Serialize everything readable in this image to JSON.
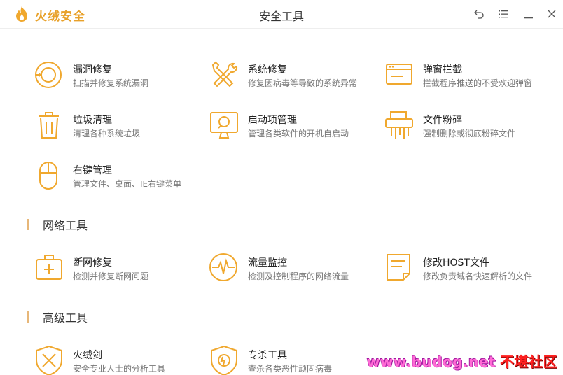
{
  "app": {
    "brand": "火绒安全",
    "window_title": "安全工具"
  },
  "colors": {
    "accent": "#f0a82e",
    "section_bar": "#e7b779",
    "text": "#333333",
    "desc": "#777777"
  },
  "sections": [
    {
      "title": "",
      "tools": [
        {
          "name": "漏洞修复",
          "desc": "扫描并修复系统漏洞",
          "icon": "vulnerability-icon"
        },
        {
          "name": "系统修复",
          "desc": "修复因病毒等导致的系统异常",
          "icon": "wrench-screwdriver-icon"
        },
        {
          "name": "弹窗拦截",
          "desc": "拦截程序推送的不受欢迎弹窗",
          "icon": "popup-window-icon"
        },
        {
          "name": "垃圾清理",
          "desc": "清理各种系统垃圾",
          "icon": "trash-icon"
        },
        {
          "name": "启动项管理",
          "desc": "管理各类软件的开机自启动",
          "icon": "monitor-startup-icon"
        },
        {
          "name": "文件粉碎",
          "desc": "强制删除或彻底粉碎文件",
          "icon": "shredder-icon"
        },
        {
          "name": "右键管理",
          "desc": "管理文件、桌面、IE右键菜单",
          "icon": "mouse-icon"
        }
      ]
    },
    {
      "title": "网络工具",
      "tools": [
        {
          "name": "断网修复",
          "desc": "检测并修复断网问题",
          "icon": "medkit-icon"
        },
        {
          "name": "流量监控",
          "desc": "检测及控制程序的网络流量",
          "icon": "traffic-wave-icon"
        },
        {
          "name": "修改HOST文件",
          "desc": "修改负责域名快速解析的文件",
          "icon": "host-file-icon"
        }
      ]
    },
    {
      "title": "高级工具",
      "tools": [
        {
          "name": "火绒剑",
          "desc": "安全专业人士的分析工具",
          "icon": "sword-shield-icon"
        },
        {
          "name": "专杀工具",
          "desc": "查杀各类恶性顽固病毒",
          "icon": "kill-shield-icon"
        }
      ]
    }
  ],
  "watermark": {
    "site": "www.budog.net",
    "label": "不堪社区"
  }
}
